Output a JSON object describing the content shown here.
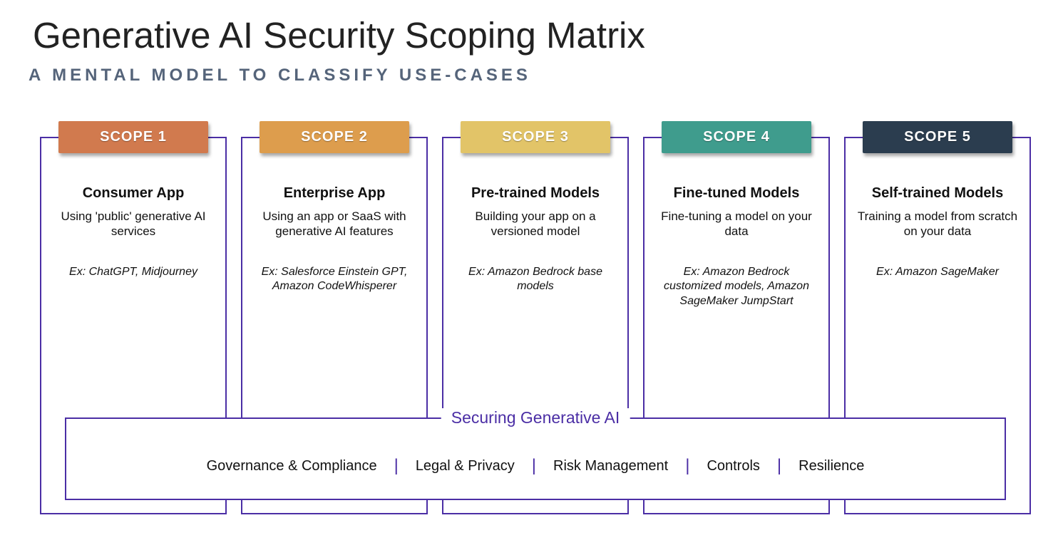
{
  "title": "Generative AI Security Scoping Matrix",
  "subtitle": "A MENTAL MODEL TO CLASSIFY USE-CASES",
  "scopes": [
    {
      "badge": "SCOPE 1",
      "name": "Consumer App",
      "desc": "Using 'public' generative AI services",
      "example": "Ex: ChatGPT, Midjourney"
    },
    {
      "badge": "SCOPE 2",
      "name": "Enterprise App",
      "desc": "Using an app or SaaS with generative AI features",
      "example": "Ex: Salesforce Einstein GPT, Amazon CodeWhisperer"
    },
    {
      "badge": "SCOPE 3",
      "name": "Pre-trained Models",
      "desc": "Building your app on a versioned model",
      "example": "Ex: Amazon Bedrock base models"
    },
    {
      "badge": "SCOPE 4",
      "name": "Fine-tuned Models",
      "desc": "Fine-tuning a model on your data",
      "example": "Ex: Amazon Bedrock customized models, Amazon SageMaker JumpStart"
    },
    {
      "badge": "SCOPE 5",
      "name": "Self-trained Models",
      "desc": "Training a model from scratch on your data",
      "example": "Ex: Amazon SageMaker"
    }
  ],
  "securing": {
    "title": "Securing Generative AI",
    "items": [
      "Governance & Compliance",
      "Legal & Privacy",
      "Risk Management",
      "Controls",
      "Resilience"
    ]
  }
}
